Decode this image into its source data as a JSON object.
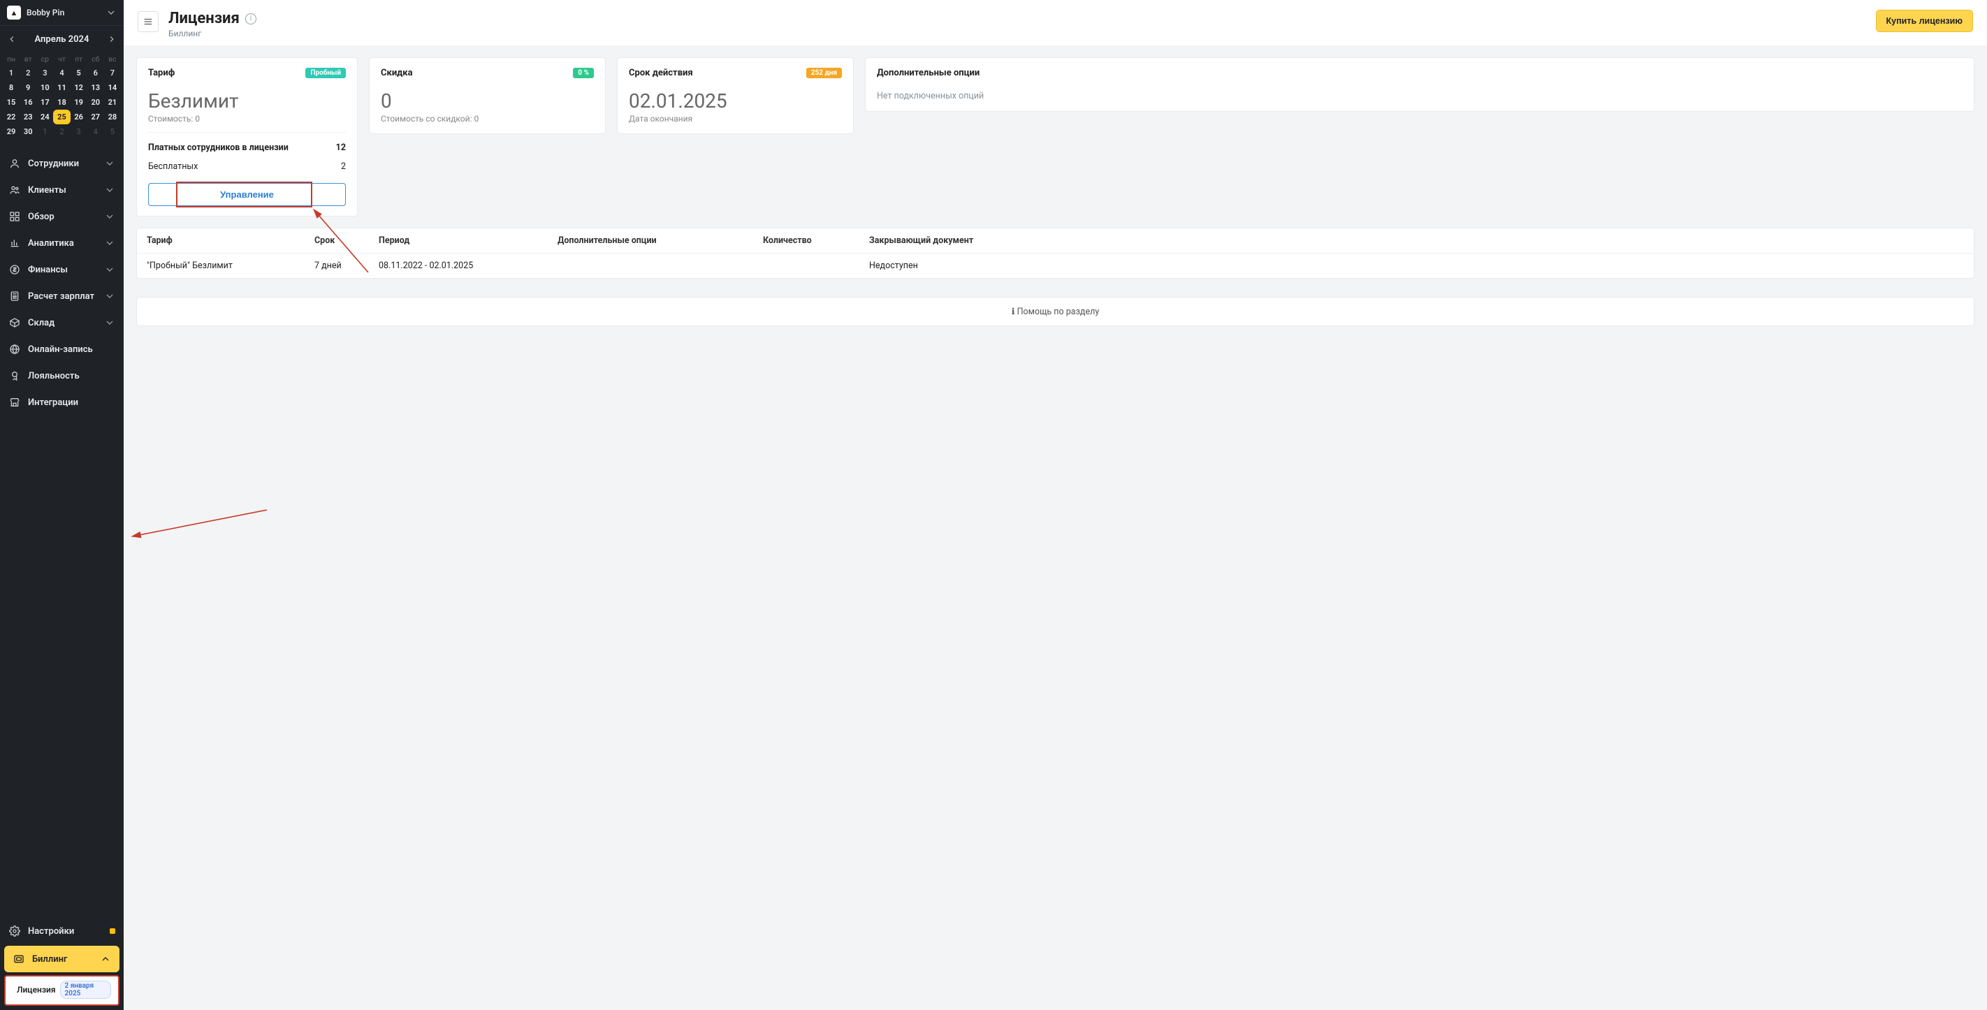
{
  "account": {
    "name": "Bobby Pin"
  },
  "calendar": {
    "title": "Апрель 2024",
    "dow": [
      "пн",
      "вт",
      "ср",
      "чт",
      "пт",
      "сб",
      "вс"
    ],
    "weeks": [
      [
        {
          "n": "1",
          "b": 0
        },
        {
          "n": "2",
          "b": 0
        },
        {
          "n": "3",
          "b": 0
        },
        {
          "n": "4",
          "b": 0
        },
        {
          "n": "5",
          "b": 1
        },
        {
          "n": "6",
          "b": 0
        },
        {
          "n": "7",
          "b": 0
        }
      ],
      [
        {
          "n": "8",
          "b": 1
        },
        {
          "n": "9",
          "b": 1
        },
        {
          "n": "10",
          "b": 1
        },
        {
          "n": "11",
          "b": 1
        },
        {
          "n": "12",
          "b": 1
        },
        {
          "n": "13",
          "b": 1
        },
        {
          "n": "14",
          "b": 1
        }
      ],
      [
        {
          "n": "15",
          "b": 1
        },
        {
          "n": "16",
          "b": 1
        },
        {
          "n": "17",
          "b": 1
        },
        {
          "n": "18",
          "b": 1
        },
        {
          "n": "19",
          "b": 1
        },
        {
          "n": "20",
          "b": 1
        },
        {
          "n": "21",
          "b": 1
        }
      ],
      [
        {
          "n": "22",
          "b": 1
        },
        {
          "n": "23",
          "b": 1
        },
        {
          "n": "24",
          "b": 1
        },
        {
          "n": "25",
          "b": 1,
          "today": 1
        },
        {
          "n": "26",
          "b": 1
        },
        {
          "n": "27",
          "b": 1
        },
        {
          "n": "28",
          "b": 1
        }
      ],
      [
        {
          "n": "29",
          "b": 1
        },
        {
          "n": "30",
          "b": 1
        },
        {
          "n": "1",
          "b": 0,
          "m": 1
        },
        {
          "n": "2",
          "b": 0,
          "m": 1
        },
        {
          "n": "3",
          "b": 0,
          "m": 1
        },
        {
          "n": "4",
          "b": 0,
          "m": 1
        },
        {
          "n": "5",
          "b": 0,
          "m": 1
        }
      ]
    ]
  },
  "nav": {
    "items": [
      {
        "label": "Сотрудники",
        "icon": "user-icon",
        "exp": true
      },
      {
        "label": "Клиенты",
        "icon": "users-icon",
        "exp": true
      },
      {
        "label": "Обзор",
        "icon": "grid-icon",
        "exp": true
      },
      {
        "label": "Аналитика",
        "icon": "chart-icon",
        "exp": true
      },
      {
        "label": "Финансы",
        "icon": "dollar-icon",
        "exp": true
      },
      {
        "label": "Расчет зарплат",
        "icon": "calc-icon",
        "exp": true
      },
      {
        "label": "Склад",
        "icon": "box-icon",
        "exp": true
      },
      {
        "label": "Онлайн-запись",
        "icon": "globe-icon"
      },
      {
        "label": "Лояльность",
        "icon": "loyalty-icon"
      },
      {
        "label": "Интеграции",
        "icon": "shop-icon"
      }
    ],
    "settings": {
      "label": "Настройки",
      "icon": "gear-icon",
      "badge": true
    },
    "billing": {
      "label": "Биллинг",
      "icon": "billing-icon",
      "active": true
    },
    "sub": {
      "label": "Лицензия",
      "badge": "2 января 2025"
    }
  },
  "header": {
    "title": "Лицензия",
    "subtitle": "Биллинг",
    "buy": "Купить лицензию"
  },
  "cards": {
    "tariff": {
      "title": "Тариф",
      "badge": "Пробный",
      "value": "Безлимит",
      "cost_label": "Стоимость: 0",
      "paid_label": "Платных сотрудников в лицензии",
      "paid_value": "12",
      "free_label": "Бесплатных",
      "free_value": "2",
      "manage": "Управление"
    },
    "discount": {
      "title": "Скидка",
      "badge": "0 %",
      "value": "0",
      "sub": "Стоимость со скидкой: 0"
    },
    "expiry": {
      "title": "Срок действия",
      "badge": "252 дня",
      "value": "02.01.2025",
      "sub": "Дата окончания"
    },
    "options": {
      "title": "Дополнительные опции",
      "empty": "Нет подключенных опций"
    }
  },
  "table": {
    "head": [
      "Тариф",
      "Срок",
      "Период",
      "Дополнительные опции",
      "Количество",
      "Закрывающий документ"
    ],
    "rows": [
      {
        "tariff": "\"Пробный\" Безлимит",
        "term": "7 дней",
        "period": "08.11.2022 - 02.01.2025",
        "opts": "",
        "qty": "",
        "doc": "Недоступен"
      }
    ]
  },
  "help": "Помощь по разделу"
}
